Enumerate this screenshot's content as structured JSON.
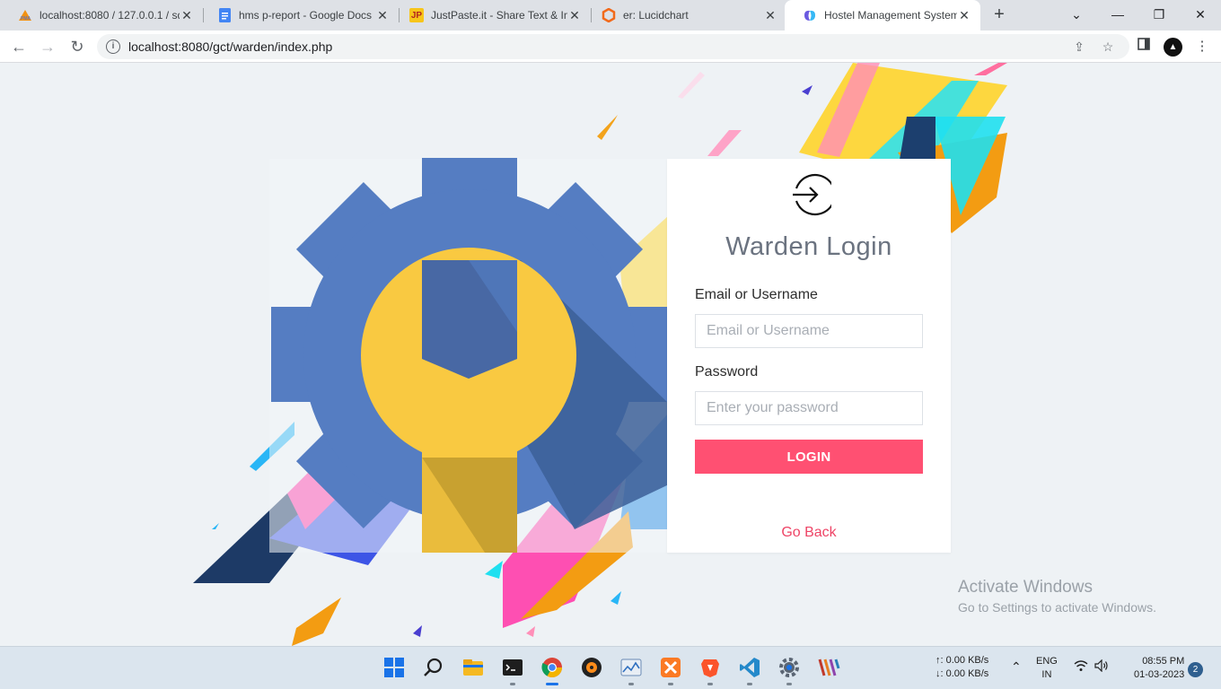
{
  "browser": {
    "tabs": [
      {
        "title": "localhost:8080 / 127.0.0.1 / sq",
        "favicon": "phpmyadmin-icon"
      },
      {
        "title": "hms p-report - Google Docs",
        "favicon": "google-docs-icon"
      },
      {
        "title": "JustPaste.it - Share Text & Im",
        "favicon": "justpaste-icon",
        "favicon_text": "JP"
      },
      {
        "title": "er: Lucidchart",
        "favicon": "lucidchart-icon"
      },
      {
        "title": "Hostel Management System",
        "favicon": "site-icon",
        "active": true
      }
    ],
    "url": "localhost:8080/gct/warden/index.php"
  },
  "login": {
    "title": "Warden Login",
    "email_label": "Email or Username",
    "email_placeholder": "Email or Username",
    "password_label": "Password",
    "password_placeholder": "Enter your password",
    "login_button": "LOGIN",
    "go_back": "Go Back"
  },
  "watermark": {
    "line1": "Activate Windows",
    "line2": "Go to Settings to activate Windows."
  },
  "taskbar": {
    "upload_speed": "↑: 0.00 KB/s",
    "download_speed": "↓: 0.00 KB/s",
    "lang_line1": "ENG",
    "lang_line2": "IN",
    "time": "08:55 PM",
    "date": "01-03-2023",
    "notification_count": "2"
  },
  "colors": {
    "accent": "#ff5072",
    "gear": "#557dc2",
    "wrench": "#f9c941"
  }
}
